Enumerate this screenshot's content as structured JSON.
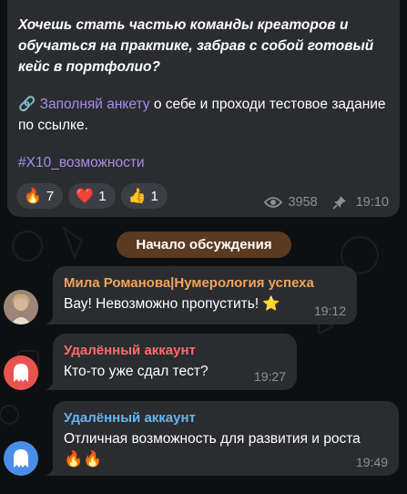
{
  "post": {
    "italic_text": "Хочешь стать частью команды креаторов и обучаться на практике, забрав с собой готовый кейс в портфолио?",
    "link_icon": "🔗",
    "link_text": "Заполняй анкету",
    "text_after_link": " о себе и проходи тестовое задание по ссылке.",
    "hashtag": "#X10_возможности",
    "reactions": [
      {
        "emoji": "🔥",
        "count": "7"
      },
      {
        "emoji": "❤️",
        "count": "1"
      },
      {
        "emoji": "👍",
        "count": "1"
      }
    ],
    "views": "3958",
    "time": "19:10"
  },
  "discussion_label": "Начало обсуждения",
  "messages": [
    {
      "author": "Мила Романова|Нумерология успеха",
      "author_color": "#f0a55a",
      "text": "Вау! Невозможно пропустить! ⭐",
      "time": "19:12"
    },
    {
      "author": "Удалённый аккаунт",
      "author_color": "#ff6b6b",
      "text": "Кто-то уже сдал тест?",
      "time": "19:27"
    },
    {
      "author": "Удалённый аккаунт",
      "author_color": "#64b5f6",
      "text": "Отличная возможность для развития и роста",
      "text2": "🔥🔥",
      "time": "19:49"
    }
  ],
  "colors": {
    "background": "#0e0f10",
    "bubble": "#2b2c2f",
    "link": "#a68de9",
    "meta": "#8c8f93",
    "discussion_pill": "#5a3a20",
    "ghost_red": "#e9534f",
    "ghost_blue": "#4a8fe7"
  }
}
